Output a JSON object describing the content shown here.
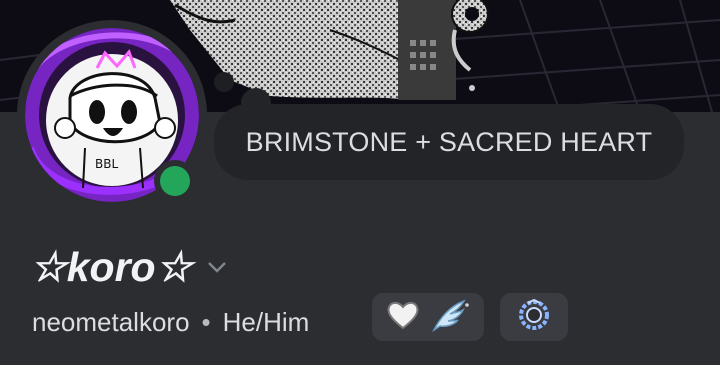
{
  "status": {
    "text": "BRIMSTONE + SACRED HEART"
  },
  "profile": {
    "display_name": "☆koro☆",
    "username": "neometalkoro",
    "separator": "•",
    "pronouns": "He/Him",
    "online_status_color": "#23a55a"
  },
  "badges": [
    {
      "icon": "heart-badge-icon"
    },
    {
      "icon": "wing-badge-icon"
    },
    {
      "icon": "laurel-badge-icon"
    }
  ],
  "colors": {
    "background": "#2b2d31",
    "bubble": "#232428",
    "badge_bg": "#3a3c42"
  }
}
